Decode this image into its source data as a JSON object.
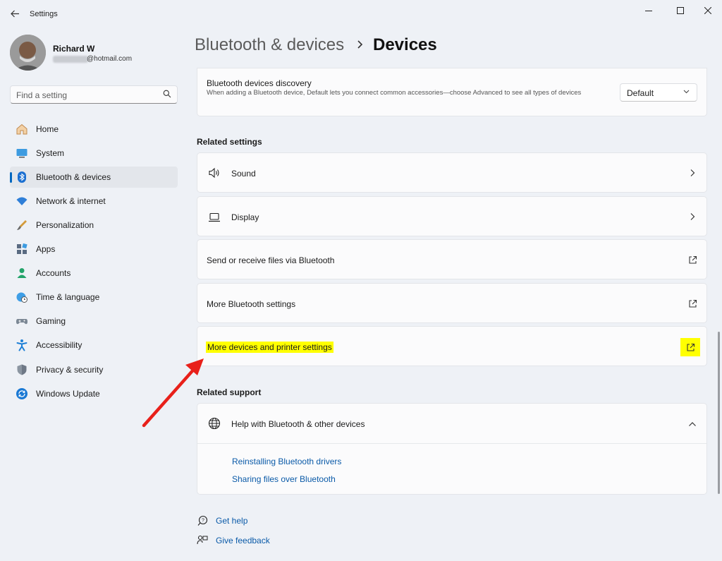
{
  "window": {
    "title": "Settings",
    "back_icon": "arrow-left-icon"
  },
  "controls": {
    "minimize": "minimize-icon",
    "maximize": "maximize-icon",
    "close": "close-icon"
  },
  "profile": {
    "name": "Richard W",
    "email_suffix": "@hotmail.com"
  },
  "search": {
    "placeholder": "Find a setting"
  },
  "nav": {
    "active_index": 2,
    "items": [
      {
        "label": "Home",
        "icon": "home-icon"
      },
      {
        "label": "System",
        "icon": "monitor-icon"
      },
      {
        "label": "Bluetooth & devices",
        "icon": "bluetooth-icon"
      },
      {
        "label": "Network & internet",
        "icon": "wifi-icon"
      },
      {
        "label": "Personalization",
        "icon": "paintbrush-icon"
      },
      {
        "label": "Apps",
        "icon": "apps-icon"
      },
      {
        "label": "Accounts",
        "icon": "person-icon"
      },
      {
        "label": "Time & language",
        "icon": "globe-clock-icon"
      },
      {
        "label": "Gaming",
        "icon": "gamepad-icon"
      },
      {
        "label": "Accessibility",
        "icon": "accessibility-icon"
      },
      {
        "label": "Privacy & security",
        "icon": "shield-icon"
      },
      {
        "label": "Windows Update",
        "icon": "refresh-icon"
      }
    ]
  },
  "breadcrumb": {
    "parent": "Bluetooth & devices",
    "separator_icon": "chevron-right-icon",
    "current": "Devices"
  },
  "discovery": {
    "title": "Bluetooth devices discovery",
    "description": "When adding a Bluetooth device, Default lets you connect common accessories—choose Advanced to see all types of devices",
    "value": "Default"
  },
  "related_settings": {
    "heading": "Related settings",
    "items": [
      {
        "label": "Sound",
        "icon": "speaker-icon",
        "trail": "chevron-right-icon"
      },
      {
        "label": "Display",
        "icon": "laptop-icon",
        "trail": "chevron-right-icon"
      },
      {
        "label": "Send or receive files via Bluetooth",
        "trail": "external-link-icon"
      },
      {
        "label": "More Bluetooth settings",
        "trail": "external-link-icon"
      },
      {
        "label": "More devices and printer settings",
        "trail": "external-link-icon",
        "highlight_color": "#ffff00"
      }
    ]
  },
  "related_support": {
    "heading": "Related support",
    "help_title": "Help with Bluetooth & other devices",
    "links": [
      "Reinstalling Bluetooth drivers",
      "Sharing files over Bluetooth"
    ]
  },
  "footer": {
    "get_help": "Get help",
    "give_feedback": "Give feedback"
  },
  "colors": {
    "accent": "#0067c0",
    "link": "#0a5aa8",
    "highlight": "#ffff00",
    "arrow": "#e8201a"
  }
}
